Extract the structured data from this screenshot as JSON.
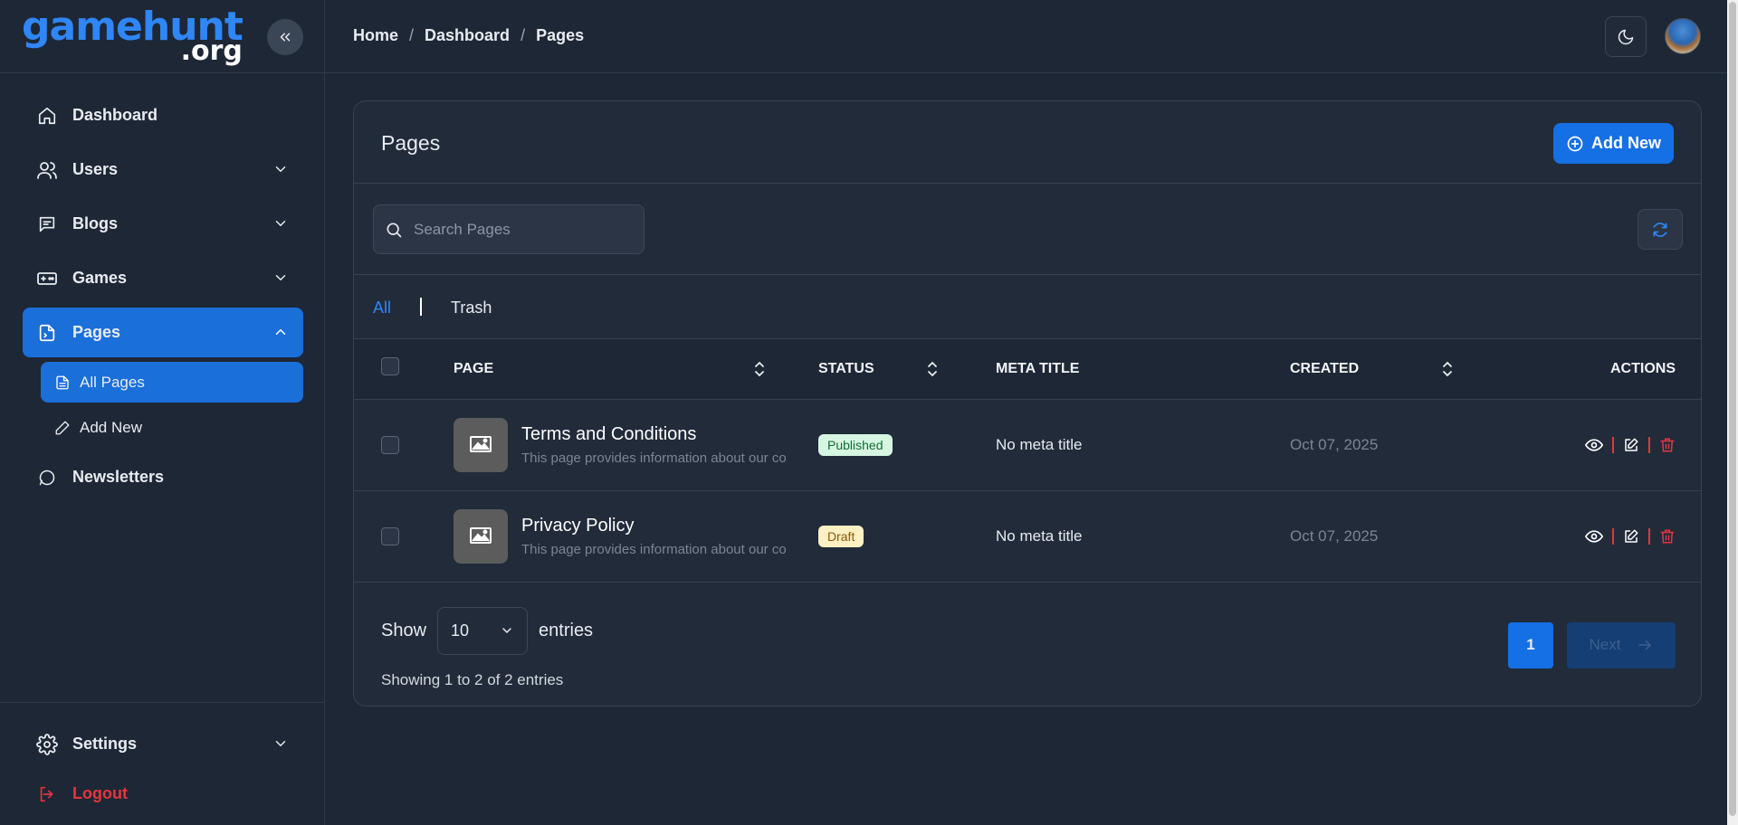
{
  "brand": {
    "line1": "gamehunt",
    "line2": ".org"
  },
  "header": {
    "breadcrumb": [
      "Home",
      "Dashboard",
      "Pages"
    ],
    "breadcrumb_sep": "/"
  },
  "sidebar": {
    "items": [
      {
        "label": "Dashboard",
        "icon": "home-icon"
      },
      {
        "label": "Users",
        "icon": "users-icon"
      },
      {
        "label": "Blogs",
        "icon": "message-icon"
      },
      {
        "label": "Games",
        "icon": "gamepad-icon"
      },
      {
        "label": "Pages",
        "icon": "file-code-icon"
      },
      {
        "label": "Newsletters",
        "icon": "chat-bubble-icon"
      }
    ],
    "sub_items": [
      {
        "label": "All Pages",
        "icon": "file-icon"
      },
      {
        "label": "Add New",
        "icon": "pencil-icon"
      }
    ],
    "settings": "Settings",
    "logout": "Logout"
  },
  "card": {
    "title": "Pages",
    "add_button": "Add New",
    "search_placeholder": "Search Pages",
    "tabs": {
      "all": "All",
      "trash": "Trash"
    },
    "columns": {
      "page": "PAGE",
      "status": "STATUS",
      "meta_title": "META TITLE",
      "created": "CREATED",
      "actions": "ACTIONS"
    },
    "rows": [
      {
        "name": "Terms and Conditions",
        "desc": "This page provides information about our co",
        "status": "Published",
        "meta": "No meta title",
        "created": "Oct 07, 2025"
      },
      {
        "name": "Privacy Policy",
        "desc": "This page provides information about our co",
        "status": "Draft",
        "meta": "No meta title",
        "created": "Oct 07, 2025"
      }
    ],
    "footer": {
      "show_label": "Show",
      "entries_value": "10",
      "entries_label": "entries",
      "showing": "Showing 1 to 2 of 2 entries",
      "page": "1",
      "next": "Next"
    }
  },
  "colors": {
    "accent": "#1570e6",
    "danger": "#e5353d",
    "background": "#1e2735"
  }
}
